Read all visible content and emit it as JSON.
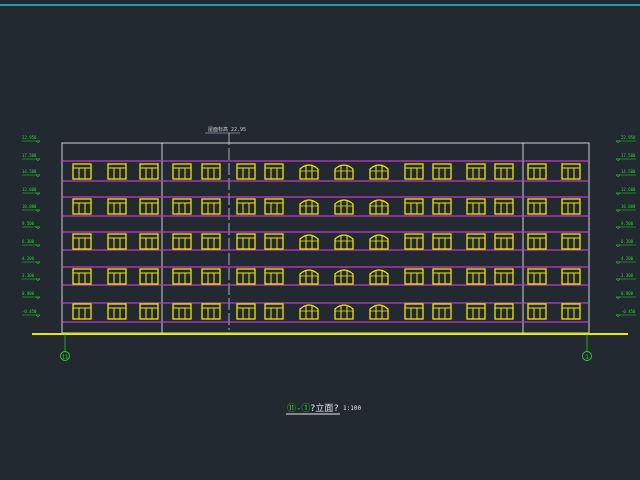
{
  "colors": {
    "background": "#222931",
    "top_rule": "#19c3d8",
    "outline": "#d0d0d0",
    "floor_line": "#c23cc8",
    "window": "#f0e800",
    "ground": "#e8e800",
    "annotation": "#28d828",
    "title": "#e8e8e8",
    "axis_line": "#28d828"
  },
  "drawing": {
    "top_annotation": "屋面标高 22.95",
    "title_prefix": "⑪-①",
    "title_text": "?立面?",
    "scale": "1:100",
    "axis_left": "11",
    "axis_right": "1",
    "window_rows": 5,
    "windows_per_row": 18,
    "arched_window_indices": [
      8,
      9,
      10
    ]
  },
  "levels_left": [
    "22.950",
    "17.500",
    "14.500",
    "12.600",
    "10.800",
    "9.500",
    "6.300",
    "4.200",
    "3.300",
    "0.900",
    "-0.450"
  ],
  "levels_right": [
    "22.950",
    "17.500",
    "14.500",
    "12.600",
    "10.800",
    "9.500",
    "6.300",
    "4.200",
    "3.300",
    "0.900",
    "-0.450"
  ]
}
